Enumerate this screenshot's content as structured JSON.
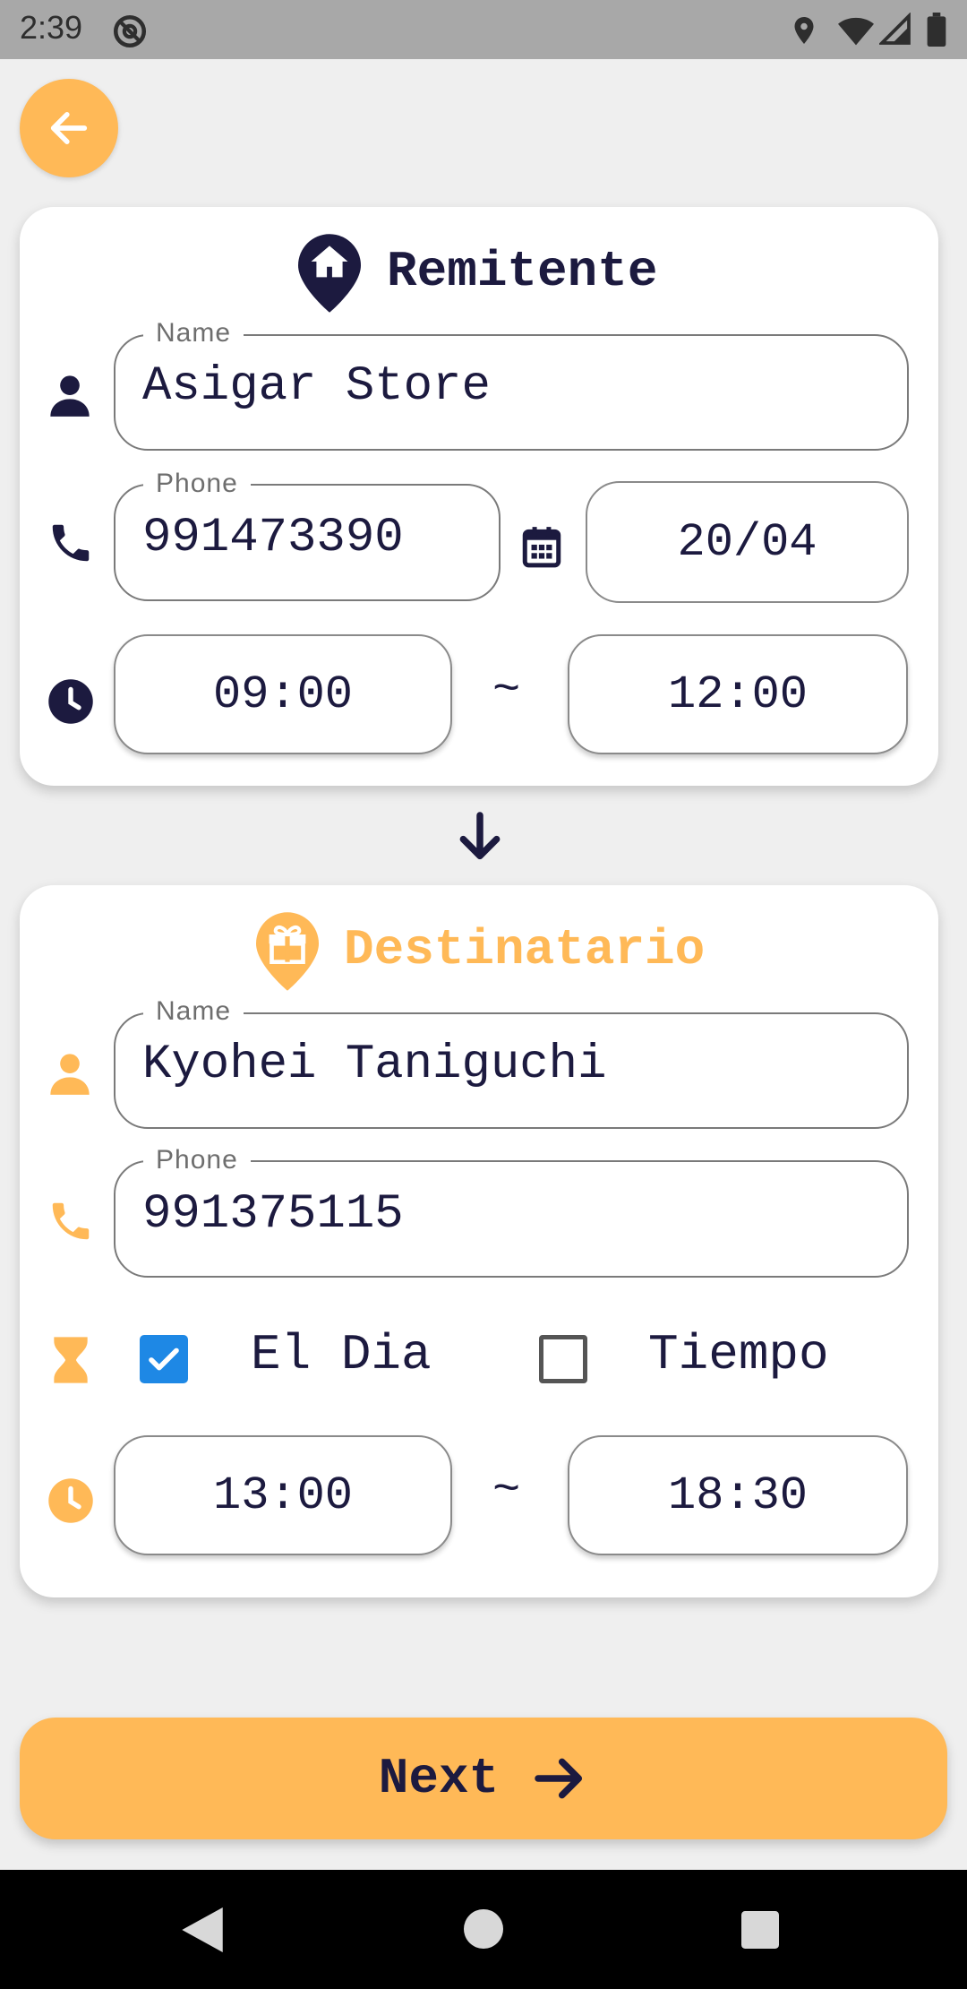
{
  "status_bar": {
    "time": "2:39"
  },
  "sender": {
    "title": "Remitente",
    "name_label": "Name",
    "name_value": "Asigar Store",
    "phone_label": "Phone",
    "phone_value": "991473390",
    "date_value": "20/04",
    "time_from": "09:00",
    "time_separator": "~",
    "time_to": "12:00"
  },
  "recipient": {
    "title": "Destinatario",
    "name_label": "Name",
    "name_value": "Kyohei Taniguchi",
    "phone_label": "Phone",
    "phone_value": "991375115",
    "option_day_label": "El Dia",
    "option_day_checked": true,
    "option_time_label": "Tiempo",
    "option_time_checked": false,
    "time_from": "13:00",
    "time_separator": "~",
    "time_to": "18:30"
  },
  "next_button": {
    "label": "Next"
  },
  "colors": {
    "accent": "#ffb957",
    "dark": "#1c1a3f",
    "checkbox": "#1e88e5"
  },
  "icons": {
    "back": "arrow-left-icon",
    "sender_pin": "home-pin-icon",
    "recipient_pin": "gift-pin-icon",
    "person": "person-icon",
    "phone": "phone-icon",
    "calendar": "calendar-icon",
    "clock": "clock-icon",
    "hourglass": "hourglass-icon",
    "down_arrow": "arrow-down-icon",
    "next_arrow": "arrow-right-icon"
  }
}
